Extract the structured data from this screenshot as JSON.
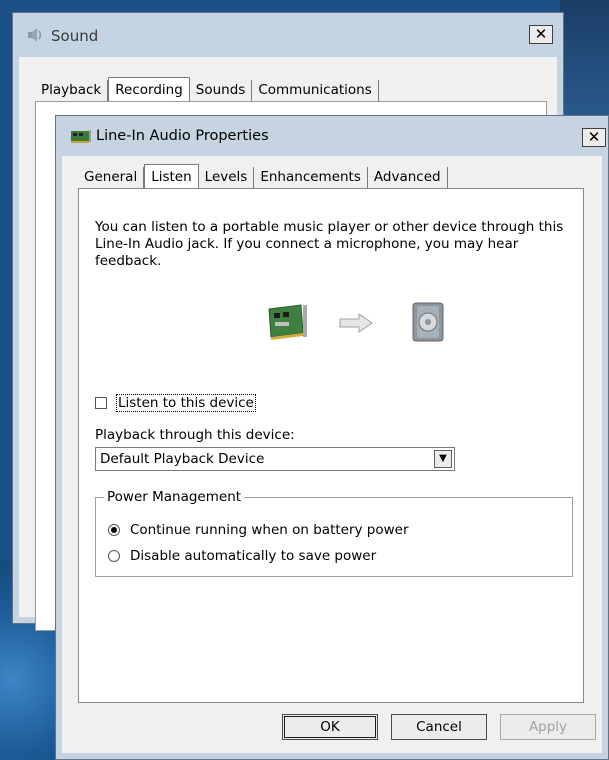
{
  "back_window": {
    "title": "Sound",
    "close_label": "✕",
    "tabs": [
      {
        "label": "Playback"
      },
      {
        "label": "Recording"
      },
      {
        "label": "Sounds"
      },
      {
        "label": "Communications"
      }
    ],
    "active_tab": "Recording"
  },
  "front_window": {
    "title": "Line-In Audio Properties",
    "close_label": "✕",
    "tabs": [
      {
        "label": "General"
      },
      {
        "label": "Listen"
      },
      {
        "label": "Levels"
      },
      {
        "label": "Enhancements"
      },
      {
        "label": "Advanced"
      }
    ],
    "active_tab": "Listen",
    "intro_text": "You can listen to a portable music player or other device through this Line-In Audio jack.  If you connect a microphone, you may hear feedback.",
    "listen_checkbox": {
      "label": "Listen to this device",
      "checked": false
    },
    "playback_label": "Playback through this device:",
    "playback_select": {
      "value": "Default Playback Device",
      "arrow": "▼"
    },
    "power_group": {
      "legend": "Power Management",
      "options": [
        {
          "label": "Continue running when on battery power",
          "selected": true
        },
        {
          "label": "Disable automatically to save power",
          "selected": false
        }
      ]
    },
    "buttons": {
      "ok": "OK",
      "cancel": "Cancel",
      "apply": "Apply"
    }
  },
  "icons": {
    "sound_window": "speaker-icon",
    "props_window": "sound-card-icon",
    "source": "sound-card-icon",
    "arrow": "arrow-right-icon",
    "target": "speaker-icon"
  },
  "colors": {
    "desktop": "#1b4f86",
    "titlebar": "#c6d3e0",
    "dialog_face": "#f0f0f0"
  }
}
